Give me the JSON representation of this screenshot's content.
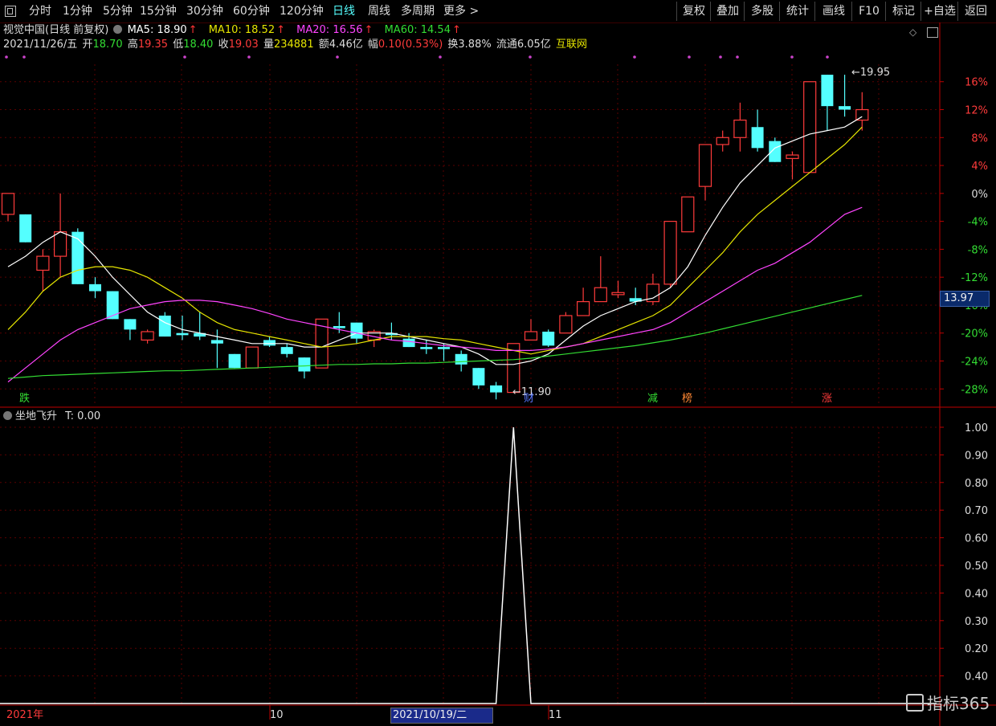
{
  "toolbar": {
    "periods": [
      "分时",
      "1分钟",
      "5分钟",
      "15分钟",
      "30分钟",
      "60分钟",
      "120分钟",
      "日线",
      "周线",
      "多周期",
      "更多 >"
    ],
    "active_period": "日线",
    "buttons": [
      "复权",
      "叠加",
      "多股",
      "统计",
      "画线",
      "F10",
      "标记",
      "+自选",
      "返回"
    ]
  },
  "header": {
    "stock_name": "视觉中国(日线 前复权)",
    "ma5_label": "MA5: 18.90",
    "ma10_label": "MA10: 18.52",
    "ma20_label": "MA20: 16.56",
    "ma60_label": "MA60: 14.54",
    "date": "2021/11/26/五",
    "open_label": "开",
    "open": "18.70",
    "high_label": "高",
    "high": "19.35",
    "low_label": "低",
    "low": "18.40",
    "close_label": "收",
    "close": "19.03",
    "vol_label": "量",
    "vol": "234881",
    "amt_label": "额",
    "amt": "4.46亿",
    "chg_label": "幅",
    "chg": "0.10(0.53%)",
    "turnover": "换3.88%",
    "float": "流通6.05亿",
    "sector": "互联网"
  },
  "colors": {
    "up": "#ff3b3b",
    "down": "#54ffff",
    "ma5": "#ffffff",
    "ma10": "#e5e500",
    "ma20": "#ff44ff",
    "ma60": "#33dd33",
    "grid": "#5a0000",
    "axis": "#c00000"
  },
  "price_box": "13.97",
  "high_label": "19.95",
  "low_label": "11.90",
  "events": [
    {
      "text": "跌",
      "color": "#33dd33"
    },
    {
      "text": "财",
      "color": "#5577ff"
    },
    {
      "text": "减",
      "color": "#33dd33"
    },
    {
      "text": "榜",
      "color": "#ff8833"
    },
    {
      "text": "涨",
      "color": "#ff3b3b"
    }
  ],
  "indicator": {
    "name": "坐地飞升",
    "value_label": "T: 0.00"
  },
  "x_labels": [
    "2021年",
    "10",
    "11"
  ],
  "selected_date": "2021/10/19/二",
  "watermark": "指标365",
  "chart_data": [
    {
      "type": "candlestick",
      "title": "视觉中国(日线 前复权)",
      "y_axis_labels": [
        "16%",
        "12%",
        "8%",
        "4%",
        "0%",
        "-4%",
        "-8%",
        "-12%",
        "-16%",
        "-20%",
        "-24%",
        "-28%"
      ],
      "y_axis_values": [
        16,
        12,
        8,
        4,
        0,
        -4,
        -8,
        -12,
        -16,
        -20,
        -24,
        -28
      ],
      "ylim": [
        -30.5,
        18.5
      ],
      "candles": [
        {
          "o": -3,
          "c": 0,
          "h": 0,
          "l": -4
        },
        {
          "o": -3,
          "c": -7,
          "h": -3,
          "l": -7
        },
        {
          "o": -11,
          "c": -9,
          "h": -8,
          "l": -14
        },
        {
          "o": -9,
          "c": -5.5,
          "h": 0,
          "l": -12
        },
        {
          "o": -5.5,
          "c": -13,
          "h": -5,
          "l": -13
        },
        {
          "o": -13,
          "c": -14,
          "h": -12,
          "l": -15
        },
        {
          "o": -14,
          "c": -18,
          "h": -14,
          "l": -18
        },
        {
          "o": -18,
          "c": -19.5,
          "h": -18,
          "l": -21
        },
        {
          "o": -21,
          "c": -19.8,
          "h": -19.5,
          "l": -21.5
        },
        {
          "o": -17.5,
          "c": -20.5,
          "h": -17,
          "l": -20.5
        },
        {
          "o": -20,
          "c": -20.3,
          "h": -17.5,
          "l": -21
        },
        {
          "o": -20,
          "c": -20.5,
          "h": -17,
          "l": -21
        },
        {
          "o": -21,
          "c": -21.5,
          "h": -19.5,
          "l": -25
        },
        {
          "o": -23,
          "c": -25,
          "h": -23,
          "l": -25
        },
        {
          "o": -25,
          "c": -22,
          "h": -22,
          "l": -25
        },
        {
          "o": -21,
          "c": -21.8,
          "h": -20.5,
          "l": -22
        },
        {
          "o": -22,
          "c": -23,
          "h": -21.5,
          "l": -23.5
        },
        {
          "o": -23.5,
          "c": -25.5,
          "h": -23.5,
          "l": -26.5
        },
        {
          "o": -25,
          "c": -18,
          "h": -18,
          "l": -25
        },
        {
          "o": -19,
          "c": -19.3,
          "h": -17,
          "l": -20
        },
        {
          "o": -18.5,
          "c": -20.8,
          "h": -18.5,
          "l": -21.5
        },
        {
          "o": -21,
          "c": -19.8,
          "h": -19.5,
          "l": -22
        },
        {
          "o": -20,
          "c": -20.3,
          "h": -18.5,
          "l": -21
        },
        {
          "o": -20.8,
          "c": -22,
          "h": -20,
          "l": -22
        },
        {
          "o": -22,
          "c": -22.3,
          "h": -21,
          "l": -23
        },
        {
          "o": -22,
          "c": -22.3,
          "h": -21.5,
          "l": -24
        },
        {
          "o": -23,
          "c": -24.5,
          "h": -22.5,
          "l": -25.5
        },
        {
          "o": -25,
          "c": -27.5,
          "h": -25,
          "l": -28
        },
        {
          "o": -27.5,
          "c": -28.5,
          "h": -27,
          "l": -29.5
        },
        {
          "o": -28.5,
          "c": -21.5,
          "h": -21.5,
          "l": -28.5
        },
        {
          "o": -21,
          "c": -19.8,
          "h": -18,
          "l": -21
        },
        {
          "o": -19.8,
          "c": -21.8,
          "h": -19.5,
          "l": -22
        },
        {
          "o": -20,
          "c": -17.5,
          "h": -17,
          "l": -20
        },
        {
          "o": -17.5,
          "c": -15.5,
          "h": -13.5,
          "l": -17.5
        },
        {
          "o": -15.5,
          "c": -13.5,
          "h": -9,
          "l": -15.5
        },
        {
          "o": -14.5,
          "c": -14.2,
          "h": -12.5,
          "l": -15
        },
        {
          "o": -15,
          "c": -15.5,
          "h": -13.5,
          "l": -16
        },
        {
          "o": -15.5,
          "c": -13,
          "h": -11.5,
          "l": -16
        },
        {
          "o": -13,
          "c": -4,
          "h": -4,
          "l": -13.5
        },
        {
          "o": -5.5,
          "c": -0.5,
          "h": -0.5,
          "l": -5.5
        },
        {
          "o": 1,
          "c": 7,
          "h": 7,
          "l": -1
        },
        {
          "o": 7,
          "c": 8,
          "h": 9,
          "l": 6
        },
        {
          "o": 8,
          "c": 10.5,
          "h": 13,
          "l": 6
        },
        {
          "o": 9.5,
          "c": 6.5,
          "h": 12,
          "l": 6
        },
        {
          "o": 7.5,
          "c": 4.5,
          "h": 8,
          "l": 4.5
        },
        {
          "o": 5,
          "c": 5.5,
          "h": 6,
          "l": 2
        },
        {
          "o": 3,
          "c": 16,
          "h": 16,
          "l": 3
        },
        {
          "o": 17,
          "c": 12.5,
          "h": 17,
          "l": 9
        },
        {
          "o": 12.5,
          "c": 12,
          "h": 17,
          "l": 11
        },
        {
          "o": 10.5,
          "c": 12,
          "h": 14.5,
          "l": 9
        }
      ],
      "series": [
        {
          "name": "MA5",
          "values": [
            -10.5,
            -9,
            -7,
            -5.5,
            -6.5,
            -9,
            -12,
            -14.5,
            -17,
            -18.5,
            -19.5,
            -20,
            -20.5,
            -21,
            -21.5,
            -21.5,
            -21.5,
            -22,
            -22,
            -21,
            -20,
            -20,
            -20,
            -20.5,
            -21,
            -21.5,
            -22,
            -23,
            -24.5,
            -24.5,
            -24,
            -23,
            -21,
            -19,
            -17.5,
            -16.5,
            -15.5,
            -15,
            -13.5,
            -10.5,
            -6,
            -2,
            1.5,
            4,
            6.5,
            7.5,
            8.5,
            9,
            9.5,
            11
          ]
        },
        {
          "name": "MA10",
          "values": [
            -19.5,
            -17,
            -14,
            -12,
            -11,
            -10.5,
            -10.5,
            -11,
            -12,
            -13.5,
            -15,
            -17,
            -18.5,
            -19.5,
            -20,
            -20.5,
            -21,
            -21.5,
            -22,
            -21.8,
            -21.5,
            -21,
            -20.5,
            -20.5,
            -20.5,
            -20.8,
            -21,
            -21.5,
            -22,
            -22.5,
            -23,
            -22.5,
            -22,
            -21.5,
            -20.5,
            -19.5,
            -18.5,
            -17.5,
            -16,
            -13.5,
            -11,
            -8.5,
            -5.5,
            -3,
            -1,
            1,
            3,
            5,
            7,
            9.5
          ]
        },
        {
          "name": "MA20",
          "values": [
            -27,
            -25,
            -23,
            -21,
            -19.5,
            -18.5,
            -17.5,
            -16.5,
            -16,
            -15.5,
            -15.3,
            -15.3,
            -15.5,
            -16,
            -16.5,
            -17.2,
            -18,
            -18.5,
            -19,
            -19.5,
            -20,
            -20.5,
            -21,
            -21.2,
            -21.5,
            -21.8,
            -22,
            -22.2,
            -22.5,
            -22.5,
            -22.5,
            -22.3,
            -22,
            -21.5,
            -21,
            -20.5,
            -20,
            -19.5,
            -18.5,
            -17,
            -15.5,
            -14,
            -12.5,
            -11,
            -10,
            -8.5,
            -7,
            -5,
            -3,
            -2
          ]
        },
        {
          "name": "MA60",
          "values": [
            -26.5,
            -26.3,
            -26.1,
            -26,
            -25.9,
            -25.8,
            -25.7,
            -25.6,
            -25.5,
            -25.4,
            -25.4,
            -25.3,
            -25.2,
            -25.1,
            -25,
            -24.9,
            -24.8,
            -24.7,
            -24.6,
            -24.5,
            -24.5,
            -24.4,
            -24.4,
            -24.3,
            -24.3,
            -24.2,
            -24.1,
            -24,
            -23.9,
            -23.8,
            -23.6,
            -23.3,
            -23,
            -22.7,
            -22.4,
            -22.1,
            -21.8,
            -21.4,
            -21,
            -20.5,
            -20,
            -19.4,
            -18.8,
            -18.2,
            -17.6,
            -17,
            -16.4,
            -15.8,
            -15.2,
            -14.6
          ]
        }
      ]
    },
    {
      "type": "line",
      "title": "坐地飞升",
      "y_axis_labels": [
        "1.00",
        "0.90",
        "0.80",
        "0.70",
        "0.60",
        "0.50",
        "0.40",
        "0.30",
        "0.20",
        "0.40"
      ],
      "y_axis_values": [
        1.0,
        0.9,
        0.8,
        0.7,
        0.6,
        0.5,
        0.4,
        0.3,
        0.2,
        0.1
      ],
      "ylim": [
        0,
        1.0
      ],
      "series": [
        {
          "values": [
            0,
            0,
            0,
            0,
            0,
            0,
            0,
            0,
            0,
            0,
            0,
            0,
            0,
            0,
            0,
            0,
            0,
            0,
            0,
            0,
            0,
            0,
            0,
            0,
            0,
            0,
            0,
            0,
            0,
            1,
            0,
            0,
            0,
            0,
            0,
            0,
            0,
            0,
            0,
            0,
            0,
            0,
            0,
            0,
            0,
            0,
            0,
            0,
            0,
            0
          ]
        }
      ]
    }
  ]
}
